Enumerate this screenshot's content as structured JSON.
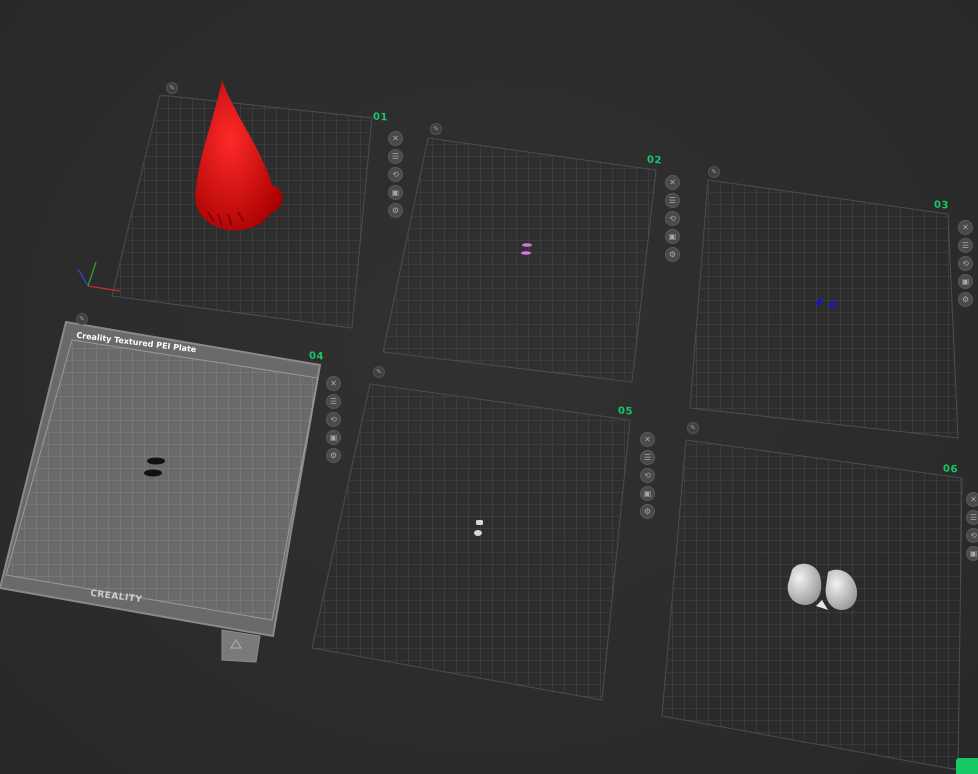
{
  "plates": [
    {
      "number": "01",
      "active": false
    },
    {
      "number": "02",
      "active": false
    },
    {
      "number": "03",
      "active": false
    },
    {
      "number": "04",
      "active": true,
      "bed_label": "Creality Textured PEI Plate",
      "logo_text": "CREALITY"
    },
    {
      "number": "05",
      "active": false
    },
    {
      "number": "06",
      "active": false
    }
  ],
  "plate_tools": {
    "close_icon": "close-icon",
    "arrange_icon": "arrange-icon",
    "orient_icon": "orient-icon",
    "lock_icon": "lock-icon",
    "settings_icon": "gear-icon"
  },
  "model_colors": {
    "plate_01": "#cc0000",
    "plate_02": "#e070e0",
    "plate_03": "#1a1aaa",
    "plate_04": "#111111",
    "plate_05": "#d8d8d8",
    "plate_06": "#d2d2d2"
  },
  "accent": "#17c964"
}
